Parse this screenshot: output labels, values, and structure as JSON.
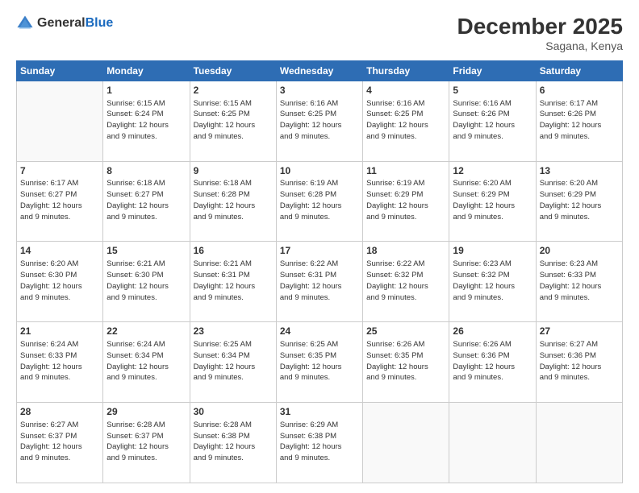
{
  "logo": {
    "general": "General",
    "blue": "Blue"
  },
  "title": "December 2025",
  "location": "Sagana, Kenya",
  "days_of_week": [
    "Sunday",
    "Monday",
    "Tuesday",
    "Wednesday",
    "Thursday",
    "Friday",
    "Saturday"
  ],
  "weeks": [
    [
      {
        "day": "",
        "sunrise": "",
        "sunset": "",
        "daylight": ""
      },
      {
        "day": "1",
        "sunrise": "Sunrise: 6:15 AM",
        "sunset": "Sunset: 6:24 PM",
        "daylight": "Daylight: 12 hours and 9 minutes."
      },
      {
        "day": "2",
        "sunrise": "Sunrise: 6:15 AM",
        "sunset": "Sunset: 6:25 PM",
        "daylight": "Daylight: 12 hours and 9 minutes."
      },
      {
        "day": "3",
        "sunrise": "Sunrise: 6:16 AM",
        "sunset": "Sunset: 6:25 PM",
        "daylight": "Daylight: 12 hours and 9 minutes."
      },
      {
        "day": "4",
        "sunrise": "Sunrise: 6:16 AM",
        "sunset": "Sunset: 6:25 PM",
        "daylight": "Daylight: 12 hours and 9 minutes."
      },
      {
        "day": "5",
        "sunrise": "Sunrise: 6:16 AM",
        "sunset": "Sunset: 6:26 PM",
        "daylight": "Daylight: 12 hours and 9 minutes."
      },
      {
        "day": "6",
        "sunrise": "Sunrise: 6:17 AM",
        "sunset": "Sunset: 6:26 PM",
        "daylight": "Daylight: 12 hours and 9 minutes."
      }
    ],
    [
      {
        "day": "7",
        "sunrise": "Sunrise: 6:17 AM",
        "sunset": "Sunset: 6:27 PM",
        "daylight": "Daylight: 12 hours and 9 minutes."
      },
      {
        "day": "8",
        "sunrise": "Sunrise: 6:18 AM",
        "sunset": "Sunset: 6:27 PM",
        "daylight": "Daylight: 12 hours and 9 minutes."
      },
      {
        "day": "9",
        "sunrise": "Sunrise: 6:18 AM",
        "sunset": "Sunset: 6:28 PM",
        "daylight": "Daylight: 12 hours and 9 minutes."
      },
      {
        "day": "10",
        "sunrise": "Sunrise: 6:19 AM",
        "sunset": "Sunset: 6:28 PM",
        "daylight": "Daylight: 12 hours and 9 minutes."
      },
      {
        "day": "11",
        "sunrise": "Sunrise: 6:19 AM",
        "sunset": "Sunset: 6:29 PM",
        "daylight": "Daylight: 12 hours and 9 minutes."
      },
      {
        "day": "12",
        "sunrise": "Sunrise: 6:20 AM",
        "sunset": "Sunset: 6:29 PM",
        "daylight": "Daylight: 12 hours and 9 minutes."
      },
      {
        "day": "13",
        "sunrise": "Sunrise: 6:20 AM",
        "sunset": "Sunset: 6:29 PM",
        "daylight": "Daylight: 12 hours and 9 minutes."
      }
    ],
    [
      {
        "day": "14",
        "sunrise": "Sunrise: 6:20 AM",
        "sunset": "Sunset: 6:30 PM",
        "daylight": "Daylight: 12 hours and 9 minutes."
      },
      {
        "day": "15",
        "sunrise": "Sunrise: 6:21 AM",
        "sunset": "Sunset: 6:30 PM",
        "daylight": "Daylight: 12 hours and 9 minutes."
      },
      {
        "day": "16",
        "sunrise": "Sunrise: 6:21 AM",
        "sunset": "Sunset: 6:31 PM",
        "daylight": "Daylight: 12 hours and 9 minutes."
      },
      {
        "day": "17",
        "sunrise": "Sunrise: 6:22 AM",
        "sunset": "Sunset: 6:31 PM",
        "daylight": "Daylight: 12 hours and 9 minutes."
      },
      {
        "day": "18",
        "sunrise": "Sunrise: 6:22 AM",
        "sunset": "Sunset: 6:32 PM",
        "daylight": "Daylight: 12 hours and 9 minutes."
      },
      {
        "day": "19",
        "sunrise": "Sunrise: 6:23 AM",
        "sunset": "Sunset: 6:32 PM",
        "daylight": "Daylight: 12 hours and 9 minutes."
      },
      {
        "day": "20",
        "sunrise": "Sunrise: 6:23 AM",
        "sunset": "Sunset: 6:33 PM",
        "daylight": "Daylight: 12 hours and 9 minutes."
      }
    ],
    [
      {
        "day": "21",
        "sunrise": "Sunrise: 6:24 AM",
        "sunset": "Sunset: 6:33 PM",
        "daylight": "Daylight: 12 hours and 9 minutes."
      },
      {
        "day": "22",
        "sunrise": "Sunrise: 6:24 AM",
        "sunset": "Sunset: 6:34 PM",
        "daylight": "Daylight: 12 hours and 9 minutes."
      },
      {
        "day": "23",
        "sunrise": "Sunrise: 6:25 AM",
        "sunset": "Sunset: 6:34 PM",
        "daylight": "Daylight: 12 hours and 9 minutes."
      },
      {
        "day": "24",
        "sunrise": "Sunrise: 6:25 AM",
        "sunset": "Sunset: 6:35 PM",
        "daylight": "Daylight: 12 hours and 9 minutes."
      },
      {
        "day": "25",
        "sunrise": "Sunrise: 6:26 AM",
        "sunset": "Sunset: 6:35 PM",
        "daylight": "Daylight: 12 hours and 9 minutes."
      },
      {
        "day": "26",
        "sunrise": "Sunrise: 6:26 AM",
        "sunset": "Sunset: 6:36 PM",
        "daylight": "Daylight: 12 hours and 9 minutes."
      },
      {
        "day": "27",
        "sunrise": "Sunrise: 6:27 AM",
        "sunset": "Sunset: 6:36 PM",
        "daylight": "Daylight: 12 hours and 9 minutes."
      }
    ],
    [
      {
        "day": "28",
        "sunrise": "Sunrise: 6:27 AM",
        "sunset": "Sunset: 6:37 PM",
        "daylight": "Daylight: 12 hours and 9 minutes."
      },
      {
        "day": "29",
        "sunrise": "Sunrise: 6:28 AM",
        "sunset": "Sunset: 6:37 PM",
        "daylight": "Daylight: 12 hours and 9 minutes."
      },
      {
        "day": "30",
        "sunrise": "Sunrise: 6:28 AM",
        "sunset": "Sunset: 6:38 PM",
        "daylight": "Daylight: 12 hours and 9 minutes."
      },
      {
        "day": "31",
        "sunrise": "Sunrise: 6:29 AM",
        "sunset": "Sunset: 6:38 PM",
        "daylight": "Daylight: 12 hours and 9 minutes."
      },
      {
        "day": "",
        "sunrise": "",
        "sunset": "",
        "daylight": ""
      },
      {
        "day": "",
        "sunrise": "",
        "sunset": "",
        "daylight": ""
      },
      {
        "day": "",
        "sunrise": "",
        "sunset": "",
        "daylight": ""
      }
    ]
  ]
}
